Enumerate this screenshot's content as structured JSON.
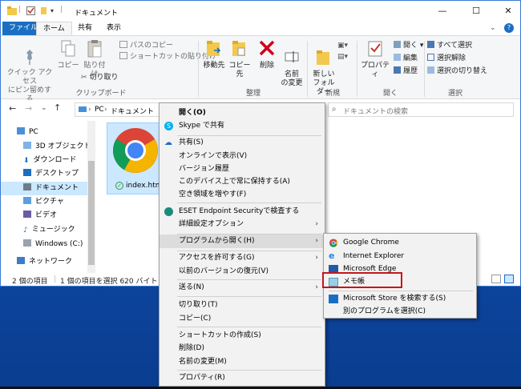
{
  "window": {
    "title": "ドキュメント"
  },
  "tabs": {
    "file": "ファイル",
    "home": "ホーム",
    "share": "共有",
    "view": "表示"
  },
  "ribbon": {
    "pin": "クイック アクセス\nにピン留めする",
    "copy": "コピー",
    "paste": "貼り付け",
    "copy_path": "パスのコピー",
    "paste_shortcut": "ショートカットの貼り付け",
    "cut": "切り取り",
    "group_clipboard": "クリップボード",
    "move_to": "移動先",
    "copy_to": "コピー先",
    "delete": "削除",
    "rename": "名前\nの変更",
    "group_organize": "整理",
    "new_folder": "新しい\nフォルダー",
    "group_new": "新規",
    "properties": "プロパティ",
    "open": "開く",
    "edit": "編集",
    "history": "履歴",
    "group_open": "開く",
    "select_all": "すべて選択",
    "select_none": "選択解除",
    "invert_selection": "選択の切り替え",
    "group_select": "選択"
  },
  "address": {
    "pc": "PC",
    "sep": "›",
    "folder": "ドキュメント",
    "search_placeholder": "ドキュメントの検索"
  },
  "nav": {
    "pc": "PC",
    "objects3d": "3D オブジェクト",
    "downloads": "ダウンロード",
    "desktop": "デスクトップ",
    "documents": "ドキュメント",
    "pictures": "ピクチャ",
    "videos": "ビデオ",
    "music": "ミュージック",
    "windows_c": "Windows (C:)",
    "network": "ネットワーク"
  },
  "file": {
    "name": "index.html"
  },
  "status": {
    "count": "2 個の項目",
    "selected": "1 個の項目を選択  620 バイト"
  },
  "context_menu": {
    "open": "開く(O)",
    "skype": "Skype で共有",
    "share": "共有(S)",
    "view_online": "オンラインで表示(V)",
    "version_history": "バージョン履歴",
    "always_keep": "このデバイス上で常に保持する(A)",
    "free_space": "空き領域を増やす(F)",
    "eset": "ESET Endpoint Securityで検査する",
    "advanced": "詳細設定オプション",
    "open_with": "プログラムから開く(H)",
    "give_access": "アクセスを許可する(G)",
    "restore": "以前のバージョンの復元(V)",
    "send_to": "送る(N)",
    "cut": "切り取り(T)",
    "copy": "コピー(C)",
    "create_shortcut": "ショートカットの作成(S)",
    "delete": "削除(D)",
    "rename": "名前の変更(M)",
    "properties": "プロパティ(R)"
  },
  "submenu": {
    "chrome": "Google Chrome",
    "ie": "Internet Explorer",
    "edge": "Microsoft Edge",
    "notepad": "メモ帳",
    "store": "Microsoft Store を検索する(S)",
    "other": "別のプログラムを選択(C)"
  },
  "colors": {
    "accent": "#1b6fc2",
    "highlight_box": "#c7151c",
    "selection": "#cce8ff"
  }
}
